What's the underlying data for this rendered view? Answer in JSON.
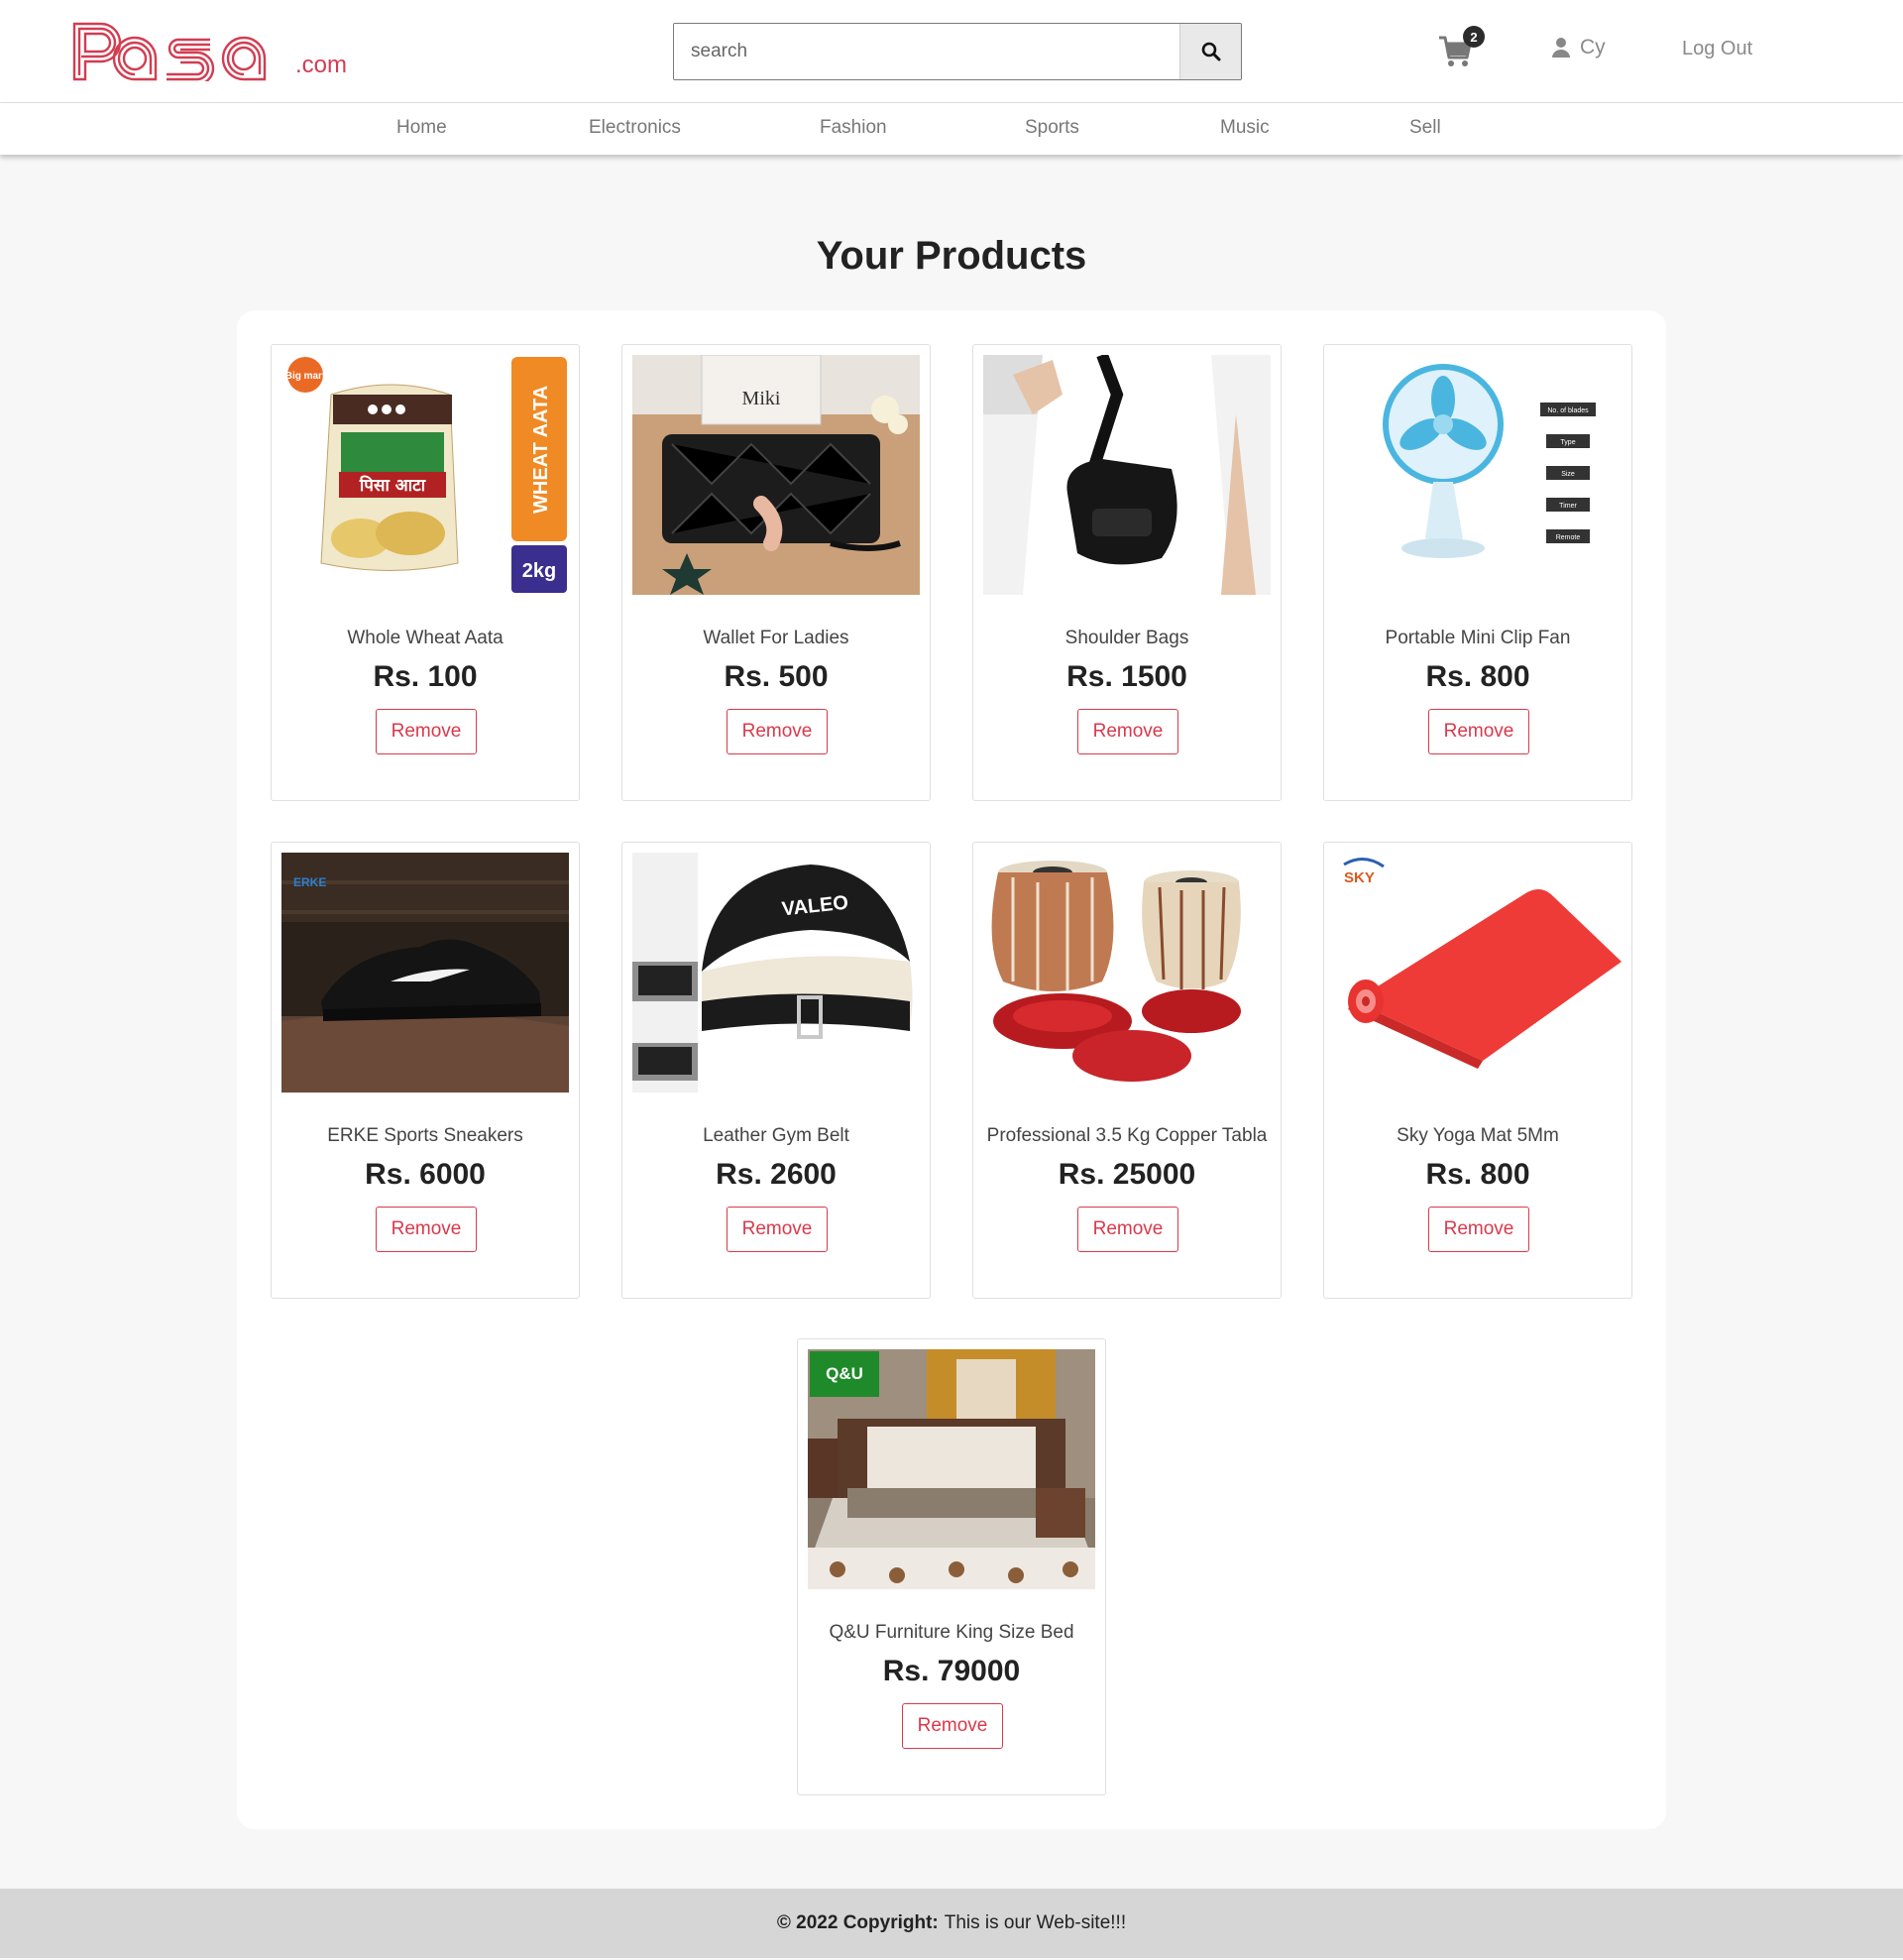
{
  "header": {
    "logo_text": "Pasa",
    "logo_suffix": ".com",
    "search_placeholder": "search",
    "cart_count": "2",
    "user_name": "Cy",
    "logout_label": "Log Out"
  },
  "nav": {
    "items": [
      {
        "label": "Home"
      },
      {
        "label": "Electronics"
      },
      {
        "label": "Fashion"
      },
      {
        "label": "Sports"
      },
      {
        "label": "Music"
      },
      {
        "label": "Sell"
      }
    ]
  },
  "main": {
    "title": "Your Products",
    "remove_label": "Remove",
    "products": [
      {
        "name": "Whole Wheat Aata",
        "price": "Rs. 100"
      },
      {
        "name": "Wallet For Ladies",
        "price": "Rs. 500"
      },
      {
        "name": "Shoulder Bags",
        "price": "Rs. 1500"
      },
      {
        "name": "Portable Mini Clip Fan",
        "price": "Rs. 800"
      },
      {
        "name": "ERKE Sports Sneakers",
        "price": "Rs. 6000"
      },
      {
        "name": "Leather Gym Belt",
        "price": "Rs. 2600"
      },
      {
        "name": "Professional 3.5 Kg Copper Tabla",
        "price": "Rs. 25000"
      },
      {
        "name": "Sky Yoga Mat 5Mm",
        "price": "Rs. 800"
      },
      {
        "name": "Q&U Furniture King Size Bed",
        "price": "Rs. 79000"
      }
    ],
    "image_labels": {
      "aata_brand": "Big mart",
      "aata_side": "WHEAT AATA",
      "aata_weight": "2kg",
      "aata_hindi": "पिसा आटा",
      "wallet_brand": "Miki",
      "sneaker_brand": "ERKE",
      "belt_brand": "VALEO",
      "yoga_brand": "SKY",
      "bed_brand": "Q&U",
      "fan_spec1": "No. of blades",
      "fan_spec2": "Type",
      "fan_spec3": "Size",
      "fan_spec4": "Timer",
      "fan_spec5": "Remote"
    }
  },
  "footer": {
    "strong": "© 2022 Copyright:",
    "text": "This is our Web-site!!!"
  },
  "colors": {
    "brand": "#d23d52",
    "remove": "#d9394c",
    "footer_bg": "#d6d6d6"
  }
}
